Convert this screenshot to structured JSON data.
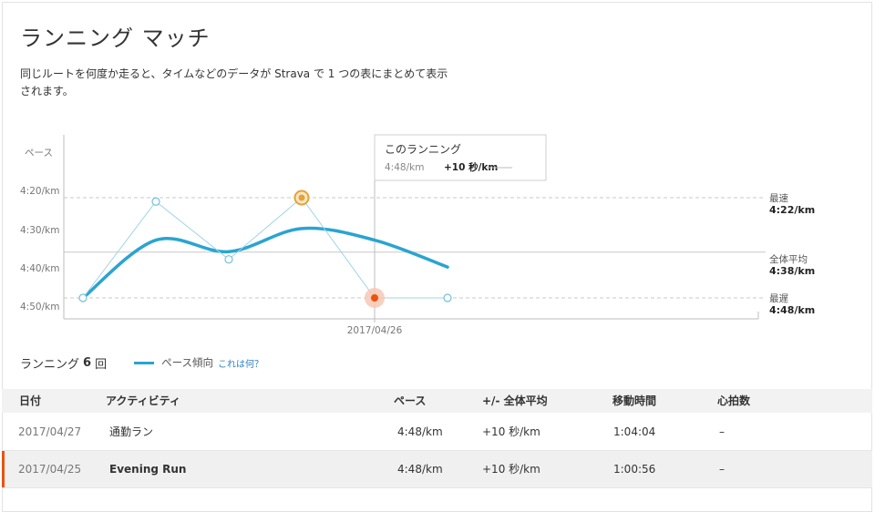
{
  "page": {
    "title": "ランニング マッチ",
    "description": "同じルートを何度か走ると、タイムなどのデータが Strava で 1 つの表にまとめて表示されます。"
  },
  "colors": {
    "trend": "#2aa4d0",
    "dots": "#9fd4e6",
    "fastest": "#e5a23a",
    "current": "#e8540f",
    "grid": "#c8c8c8",
    "accent": "#e8540f"
  },
  "chart": {
    "ylabel": "ペース",
    "ticks": [
      "4:20/km",
      "4:30/km",
      "4:40/km",
      "4:50/km"
    ],
    "x_label": "2017/04/26",
    "tooltip": {
      "title": "このランニング",
      "pace": "4:48/km",
      "diff": "+10 秒/km"
    },
    "refs": {
      "fastest": {
        "label": "最速",
        "value": "4:22/km"
      },
      "average": {
        "label": "全体平均",
        "value": "4:38/km"
      },
      "slowest": {
        "label": "最遅",
        "value": "4:48/km"
      }
    }
  },
  "chart_data": {
    "type": "line",
    "ylabel": "ペース",
    "y_unit": "seconds per km",
    "y_inverted": true,
    "ylim": [
      255,
      292
    ],
    "points": [
      {
        "index": 0,
        "pace_s": 288
      },
      {
        "index": 1,
        "pace_s": 263,
        "label": ""
      },
      {
        "index": 2,
        "pace_s": 278
      },
      {
        "index": 3,
        "pace_s": 262,
        "marker": "fastest"
      },
      {
        "index": 4,
        "pace_s": 288,
        "marker": "current"
      },
      {
        "index": 5,
        "pace_s": 288
      }
    ],
    "trend": [
      {
        "index": 0,
        "pace_s": 288
      },
      {
        "index": 1,
        "pace_s": 273
      },
      {
        "index": 2,
        "pace_s": 276
      },
      {
        "index": 3,
        "pace_s": 270
      },
      {
        "index": 4,
        "pace_s": 273
      },
      {
        "index": 5,
        "pace_s": 280
      }
    ],
    "reference_lines": {
      "fastest": 262,
      "average": 278,
      "slowest": 288
    },
    "current_index": 4
  },
  "legend": {
    "prefix": "ランニング",
    "count": "6",
    "suffix": "回",
    "trend_label": "ペース傾向",
    "help_link": "これは何？"
  },
  "table": {
    "headers": [
      "日付",
      "アクティビティ",
      "ペース",
      "+/- 全体平均",
      "移動時間",
      "心拍数"
    ],
    "rows": [
      {
        "date": "2017/04/27",
        "activity": "通勤ラン",
        "pace": "4:48/km",
        "diff": "+10 秒/km",
        "time": "1:04:04",
        "hr": "–"
      },
      {
        "date": "2017/04/25",
        "activity": "Evening Run",
        "pace": "4:48/km",
        "diff": "+10 秒/km",
        "time": "1:00:56",
        "hr": "–"
      }
    ]
  }
}
